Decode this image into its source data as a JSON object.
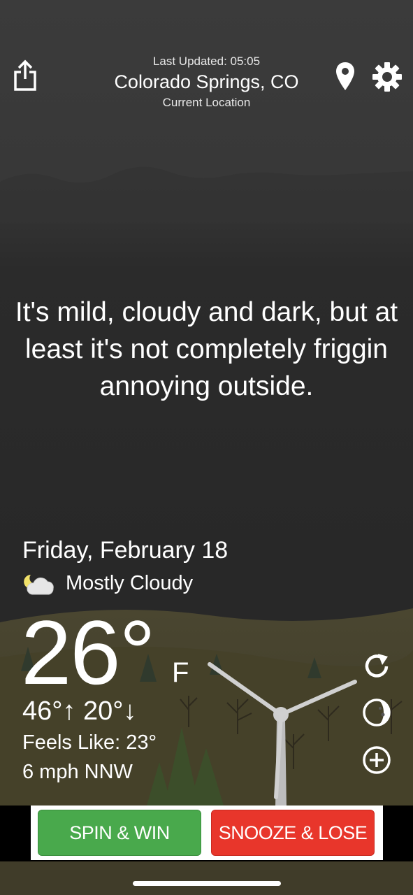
{
  "header": {
    "last_updated": "Last Updated: 05:05",
    "city": "Colorado Springs, CO",
    "location_label": "Current Location"
  },
  "message": "It's mild, cloudy and dark, but at least it's not completely friggin annoying outside.",
  "forecast": {
    "date": "Friday, February 18",
    "condition": "Mostly Cloudy",
    "condition_icon": "partly-cloudy-night-icon",
    "temperature": "26°",
    "unit": "F",
    "high": "46°",
    "low": "20°",
    "feels_like": "Feels Like: 23°",
    "wind": "6 mph NNW"
  },
  "actions": {
    "share_icon": "share-icon",
    "location_icon": "location-pin-icon",
    "settings_icon": "gear-icon",
    "refresh_icon": "refresh-icon",
    "moon_icon": "moon-phase-icon",
    "add_icon": "add-circle-icon"
  },
  "ad": {
    "spin_label": "SPIN & WIN",
    "snooze_label": "SNOOZE & LOSE"
  },
  "colors": {
    "spin": "#49a94c",
    "snooze": "#e8362b",
    "sky": "#2a2a2a"
  }
}
